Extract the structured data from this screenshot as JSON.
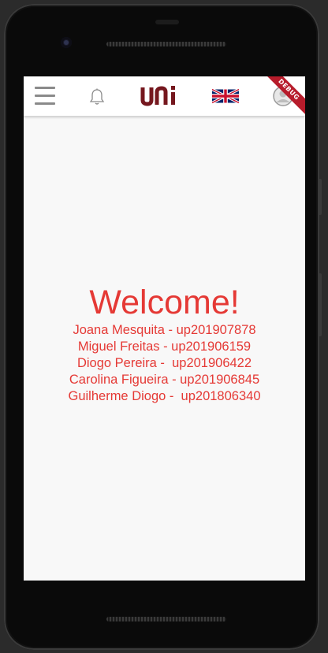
{
  "app": {
    "logo_text": "uni",
    "debug_banner": "DEBUG"
  },
  "appbar": {
    "icons": [
      "menu-icon",
      "bell-icon",
      "uk-flag-icon",
      "profile-icon"
    ],
    "language_flag": "uk"
  },
  "main": {
    "welcome": "Welcome!",
    "members": [
      "Joana Mesquita - up201907878",
      "Miguel Freitas - up201906159",
      "Diogo Pereira -  up201906422",
      "Carolina Figueira - up201906845",
      "Guilherme Diogo -  up201806340"
    ]
  },
  "colors": {
    "accent": "#e53935",
    "brand": "#75171e",
    "background": "#f8f8f8",
    "appbar": "#ffffff",
    "icon_grey": "#8a8a8a",
    "debug_ribbon": "#b71c2b"
  }
}
